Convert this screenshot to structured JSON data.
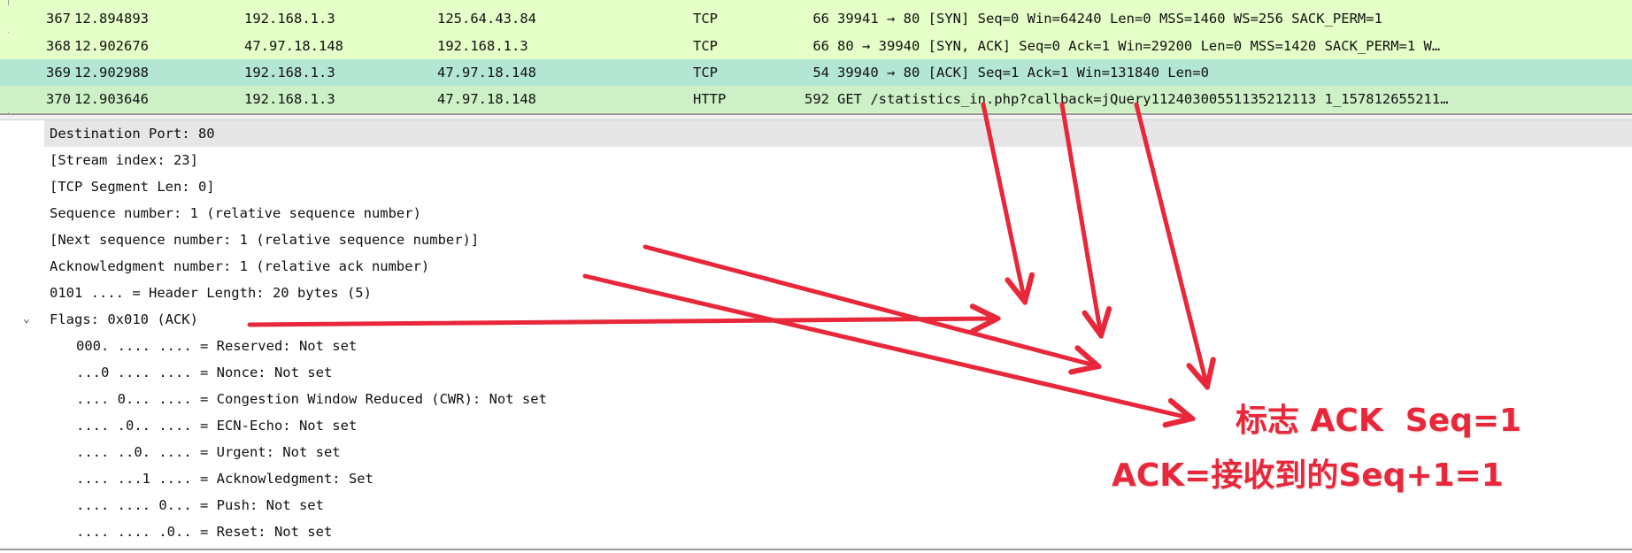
{
  "colors": {
    "tcp_row": "#e4ffc7",
    "selected_row": "#b4e6d4",
    "http_row": "#cdf0c6",
    "annotation": "#e8283a",
    "selected_detail": "#e6e6e6"
  },
  "packets": [
    {
      "no": "367",
      "time": "12.894893",
      "source": "192.168.1.3",
      "destination": "125.64.43.84",
      "protocol": "TCP",
      "length": "66",
      "info": "39941 → 80 [SYN] Seq=0 Win=64240 Len=0 MSS=1460 WS=256 SACK_PERM=1"
    },
    {
      "no": "368",
      "time": "12.902676",
      "source": "47.97.18.148",
      "destination": "192.168.1.3",
      "protocol": "TCP",
      "length": "66",
      "info": "80 → 39940 [SYN, ACK] Seq=0 Ack=1 Win=29200 Len=0 MSS=1420 SACK_PERM=1 W…"
    },
    {
      "no": "369",
      "time": "12.902988",
      "source": "192.168.1.3",
      "destination": "47.97.18.148",
      "protocol": "TCP",
      "length": "54",
      "info": "39940 → 80 [ACK] Seq=1 Ack=1 Win=131840 Len=0"
    },
    {
      "no": "370",
      "time": "12.903646",
      "source": "192.168.1.3",
      "destination": "47.97.18.148",
      "protocol": "HTTP",
      "length": "592",
      "info": "GET /statistics_in.php?callback=jQuery11240300551135212113 1_157812655211…"
    }
  ],
  "details": [
    {
      "text": "Destination Port: 80"
    },
    {
      "text": "[Stream index: 23]"
    },
    {
      "text": "[TCP Segment Len: 0]"
    },
    {
      "text": "Sequence number: 1    (relative sequence number)"
    },
    {
      "text": "[Next sequence number: 1    (relative sequence number)]"
    },
    {
      "text": "Acknowledgment number: 1    (relative ack number)"
    },
    {
      "text": "0101 .... = Header Length: 20 bytes (5)"
    },
    {
      "text": "Flags: 0x010 (ACK)"
    },
    {
      "text": "000. .... .... = Reserved: Not set"
    },
    {
      "text": "...0 .... .... = Nonce: Not set"
    },
    {
      "text": ".... 0... .... = Congestion Window Reduced (CWR): Not set"
    },
    {
      "text": ".... .0.. .... = ECN-Echo: Not set"
    },
    {
      "text": ".... ..0. .... = Urgent: Not set"
    },
    {
      "text": ".... ...1 .... = Acknowledgment: Set"
    },
    {
      "text": ".... .... 0... = Push: Not set"
    },
    {
      "text": ".... .... .0.. = Reset: Not set"
    }
  ],
  "flags_chevron": "chevron-down-icon",
  "annotations": {
    "line1": "标志 ACK  Seq=1",
    "line2": "ACK=接收到的Seq+1=1"
  }
}
